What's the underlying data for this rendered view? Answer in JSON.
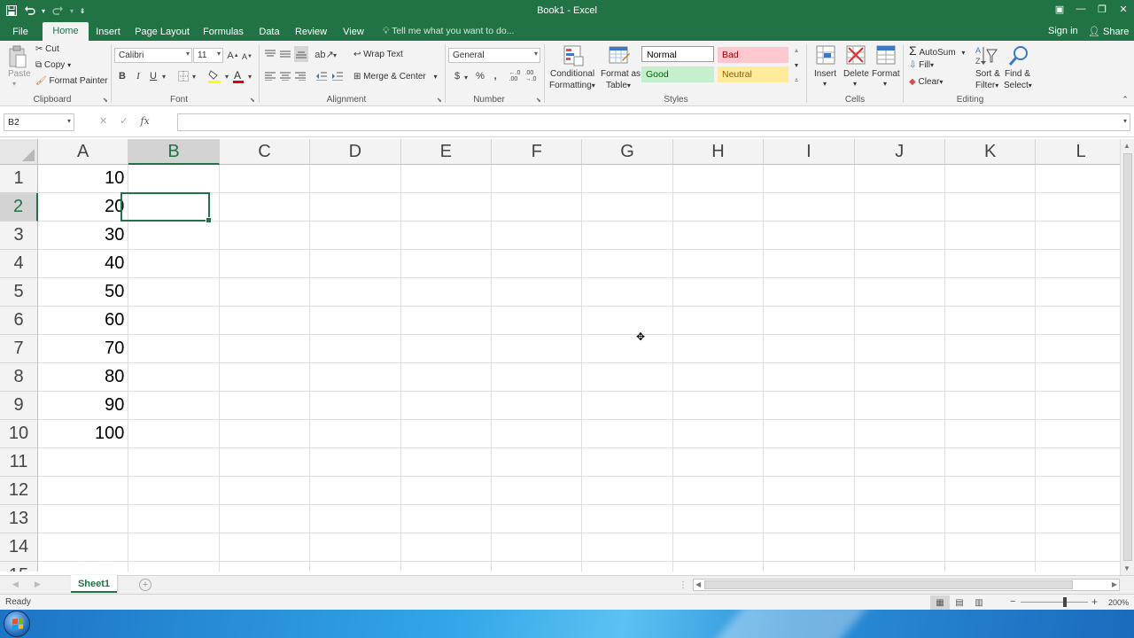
{
  "window": {
    "title": "Book1 - Excel"
  },
  "qat": {
    "save_icon": "save-icon",
    "undo_icon": "undo-icon",
    "redo_icon": "redo-icon"
  },
  "tabs": [
    "File",
    "Home",
    "Insert",
    "Page Layout",
    "Formulas",
    "Data",
    "Review",
    "View"
  ],
  "active_tab": "Home",
  "tellme_placeholder": "Tell me what you want to do...",
  "account": {
    "signin": "Sign in",
    "share": "Share"
  },
  "ribbon": {
    "clipboard": {
      "label": "Clipboard",
      "paste": "Paste",
      "cut": "Cut",
      "copy": "Copy",
      "format_painter": "Format Painter"
    },
    "font": {
      "label": "Font",
      "name": "Calibri",
      "size": "11",
      "bold": "B",
      "italic": "I",
      "underline": "U"
    },
    "alignment": {
      "label": "Alignment",
      "wrap_text": "Wrap Text",
      "merge_center": "Merge & Center"
    },
    "number": {
      "label": "Number",
      "format": "General",
      "currency": "$",
      "percent": "%"
    },
    "styles": {
      "label": "Styles",
      "conditional_1": "Conditional",
      "conditional_2": "Formatting",
      "format_table_1": "Format as",
      "format_table_2": "Table",
      "normal": "Normal",
      "bad": "Bad",
      "good": "Good",
      "neutral": "Neutral"
    },
    "cells": {
      "label": "Cells",
      "insert": "Insert",
      "delete": "Delete",
      "format": "Format"
    },
    "editing": {
      "label": "Editing",
      "autosum": "AutoSum",
      "fill": "Fill",
      "clear": "Clear",
      "sort_1": "Sort &",
      "sort_2": "Filter",
      "find_1": "Find &",
      "find_2": "Select"
    }
  },
  "formula_bar": {
    "name_box": "B2",
    "fx": "fx",
    "content": ""
  },
  "grid": {
    "columns": [
      "A",
      "B",
      "C",
      "D",
      "E",
      "F",
      "G",
      "H",
      "I",
      "J",
      "K",
      "L"
    ],
    "rows": [
      "1",
      "2",
      "3",
      "4",
      "5",
      "6",
      "7",
      "8",
      "9",
      "10",
      "11",
      "12",
      "13",
      "14",
      "15"
    ],
    "column_a_values": [
      "10",
      "20",
      "30",
      "40",
      "50",
      "60",
      "70",
      "80",
      "90",
      "100"
    ],
    "selected_cell": "B2"
  },
  "sheets": [
    "Sheet1"
  ],
  "status": {
    "text": "Ready",
    "zoom": "200%"
  },
  "colors": {
    "accent": "#217346",
    "bad_fill": "#ffc7ce",
    "good_fill": "#c6efce",
    "neutral_fill": "#ffeb9c"
  }
}
